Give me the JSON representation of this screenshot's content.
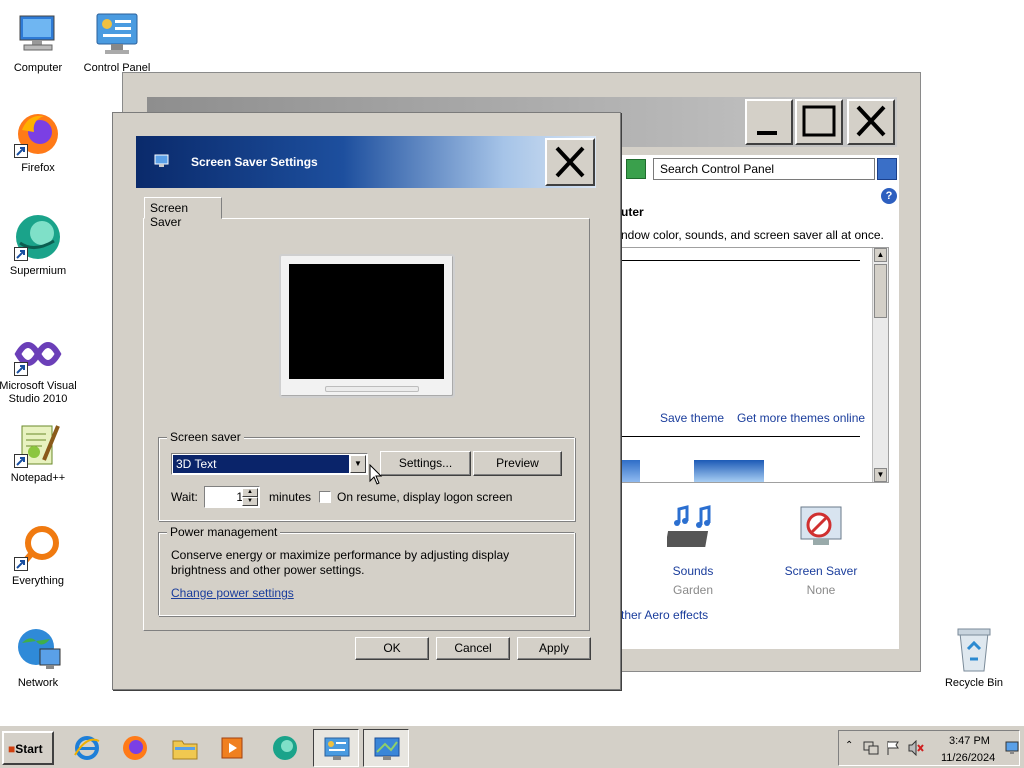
{
  "desktop": {
    "icons": [
      {
        "label": "Computer"
      },
      {
        "label": "Control Panel"
      },
      {
        "label": "Firefox"
      },
      {
        "label": "Supermium"
      },
      {
        "label": "Microsoft Visual Studio 2010"
      },
      {
        "label": "Notepad++"
      },
      {
        "label": "Everything"
      },
      {
        "label": "Network"
      },
      {
        "label": "Recycle Bin"
      }
    ]
  },
  "control_panel": {
    "search_placeholder": "Search Control Panel",
    "heading_partial": "uter",
    "description_partial": "ndow color, sounds, and screen saver all at once.",
    "save_theme": "Save theme",
    "more_themes": "Get more themes online",
    "items": [
      {
        "name": "Sounds",
        "value": "Garden",
        "icon": "speaker-notes-icon"
      },
      {
        "name": "Screen Saver",
        "value": "None",
        "icon": "screen-saver-icon"
      }
    ],
    "aero_link_partial": "ther Aero effects"
  },
  "dialog": {
    "title": "Screen Saver Settings",
    "tab": "Screen Saver",
    "screen_saver_group": "Screen saver",
    "selected_saver": "3D Text",
    "settings_button": "Settings...",
    "preview_button": "Preview",
    "wait_label": "Wait:",
    "wait_value": "1",
    "minutes_label": "minutes",
    "resume_label": "On resume, display logon screen",
    "resume_checked": false,
    "power_group": "Power management",
    "power_desc": "Conserve energy or maximize performance by adjusting display brightness and other power settings.",
    "power_link": "Change power settings",
    "ok": "OK",
    "cancel": "Cancel",
    "apply": "Apply"
  },
  "taskbar": {
    "start": "Start",
    "time": "3:47 PM",
    "date": "11/26/2024"
  },
  "colors": {
    "title_gradient_start": "#0a2a6b",
    "selection": "#0a246a",
    "link": "#1a3d9c",
    "face": "#d4d0c8"
  }
}
